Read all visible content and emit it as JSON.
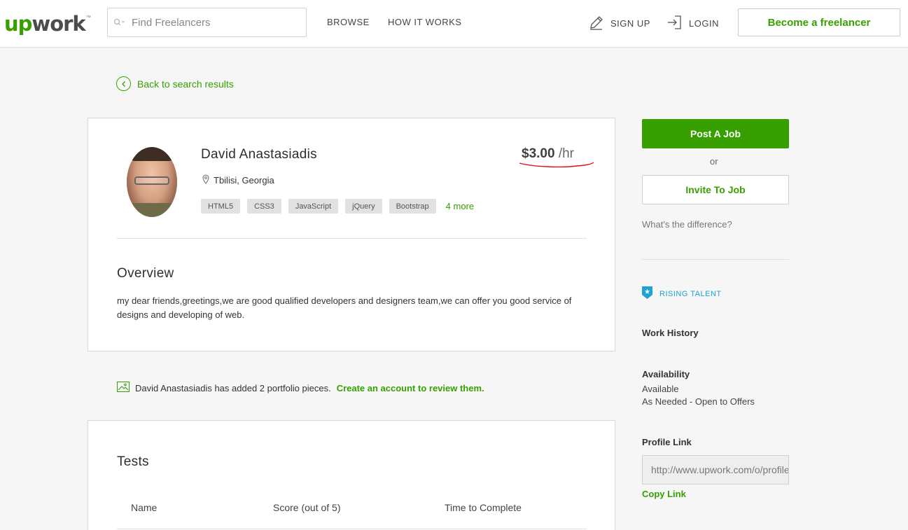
{
  "header": {
    "logo_up": "up",
    "logo_work": "work",
    "logo_tm": "™",
    "search_placeholder": "Find Freelancers",
    "nav": [
      "BROWSE",
      "HOW IT WORKS"
    ],
    "signup": "SIGN UP",
    "login": "LOGIN",
    "become_freelancer": "Become a freelancer"
  },
  "back_link": "Back to search results",
  "profile": {
    "name": "David Anastasiadis",
    "rate_amount": "$3.00",
    "rate_unit": "/hr",
    "location": "Tbilisi, Georgia",
    "skills": [
      "HTML5",
      "CSS3",
      "JavaScript",
      "jQuery",
      "Bootstrap"
    ],
    "more_skills": "4 more",
    "overview_title": "Overview",
    "overview_text": "my dear friends,greetings,we are good qualified developers and designers team,we can offer you good service of designs and developing of web."
  },
  "portfolio": {
    "text": "David Anastasiadis has added 2 portfolio pieces.",
    "link": "Create an account to review them."
  },
  "tests": {
    "title": "Tests",
    "columns": [
      "Name",
      "Score (out of 5)",
      "Time to Complete"
    ]
  },
  "sidebar": {
    "post_job": "Post A Job",
    "or": "or",
    "invite": "Invite To Job",
    "difference": "What's the difference?",
    "rising_talent": "RISING TALENT",
    "work_history": "Work History",
    "availability_label": "Availability",
    "availability_value": "Available",
    "availability_detail": "As Needed - Open to Offers",
    "profile_link_label": "Profile Link",
    "profile_link_value": "http://www.upwork.com/o/profiles/users/",
    "copy_link": "Copy Link"
  },
  "colors": {
    "brand_green": "#37a000",
    "rising_blue": "#1fa3d4",
    "annotation_red": "#e0101a"
  }
}
